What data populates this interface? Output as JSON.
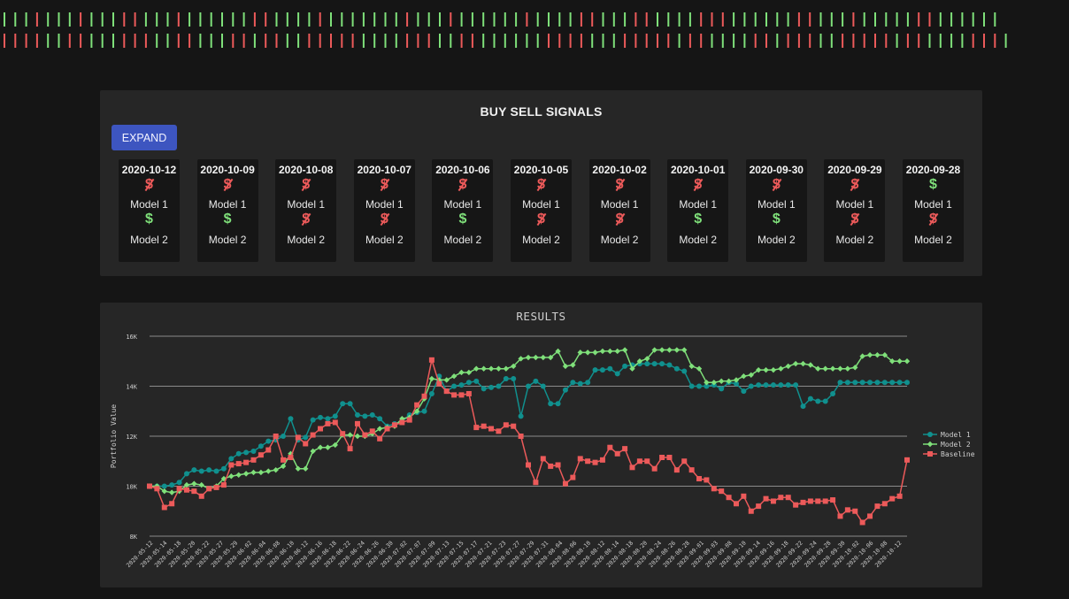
{
  "ticker_strip": {
    "colors": {
      "buy": "#7fe07a",
      "sell": "#ec5a5a"
    },
    "row1": "BBBSBBBSBBBSSBBBSBBBBBBSSBBBBSBBBBBBBSBBBSBBBBBBSBBBBSSBBBSSBBBBSSSBBBBBBSSBBBSBBBBBSSBBBBBB",
    "row2": "SSSSBBSSBBBSSSBBSSBBBSSBSSBBSSSSSBBBBSSSBBSSBBBBBBSSSSBBBSSSSSBSSBBBBSSBSSSBBSSSSSBSSBBBBSSSB"
  },
  "signals": {
    "title": "BUY SELL SIGNALS",
    "expand_label": "EXPAND",
    "icon_names": {
      "buy": "dollar-icon",
      "sell": "no-dollar-icon"
    },
    "cards": [
      {
        "date": "2020-10-12",
        "m1": "sell",
        "m1_label": "Model 1",
        "m2": "buy",
        "m2_label": "Model 2"
      },
      {
        "date": "2020-10-09",
        "m1": "sell",
        "m1_label": "Model 1",
        "m2": "buy",
        "m2_label": "Model 2"
      },
      {
        "date": "2020-10-08",
        "m1": "sell",
        "m1_label": "Model 1",
        "m2": "sell",
        "m2_label": "Model 2"
      },
      {
        "date": "2020-10-07",
        "m1": "sell",
        "m1_label": "Model 1",
        "m2": "sell",
        "m2_label": "Model 2"
      },
      {
        "date": "2020-10-06",
        "m1": "sell",
        "m1_label": "Model 1",
        "m2": "buy",
        "m2_label": "Model 2"
      },
      {
        "date": "2020-10-05",
        "m1": "sell",
        "m1_label": "Model 1",
        "m2": "sell",
        "m2_label": "Model 2"
      },
      {
        "date": "2020-10-02",
        "m1": "sell",
        "m1_label": "Model 1",
        "m2": "sell",
        "m2_label": "Model 2"
      },
      {
        "date": "2020-10-01",
        "m1": "sell",
        "m1_label": "Model 1",
        "m2": "buy",
        "m2_label": "Model 2"
      },
      {
        "date": "2020-09-30",
        "m1": "sell",
        "m1_label": "Model 1",
        "m2": "buy",
        "m2_label": "Model 2"
      },
      {
        "date": "2020-09-29",
        "m1": "sell",
        "m1_label": "Model 1",
        "m2": "sell",
        "m2_label": "Model 2"
      },
      {
        "date": "2020-09-28",
        "m1": "buy",
        "m1_label": "Model 1",
        "m2": "sell",
        "m2_label": "Model 2"
      }
    ]
  },
  "results": {
    "title": "RESULTS"
  },
  "chart_data": {
    "type": "line",
    "title": "RESULTS",
    "xlabel": "",
    "ylabel": "Portfolio Value",
    "ylim": [
      8000,
      16000
    ],
    "yticks": [
      8000,
      10000,
      12000,
      14000,
      16000
    ],
    "ytick_labels": [
      "8K",
      "10K",
      "12K",
      "14K",
      "16K"
    ],
    "grid": true,
    "legend_position": "right",
    "x_tick_labels": [
      "2020-05-12",
      "2020-05-14",
      "2020-05-18",
      "2020-05-20",
      "2020-05-22",
      "2020-05-27",
      "2020-05-29",
      "2020-06-02",
      "2020-06-04",
      "2020-06-08",
      "2020-06-10",
      "2020-06-12",
      "2020-06-16",
      "2020-06-18",
      "2020-06-22",
      "2020-06-24",
      "2020-06-26",
      "2020-06-30",
      "2020-07-02",
      "2020-07-07",
      "2020-07-09",
      "2020-07-13",
      "2020-07-15",
      "2020-07-17",
      "2020-07-21",
      "2020-07-23",
      "2020-07-27",
      "2020-07-29",
      "2020-07-31",
      "2020-08-04",
      "2020-08-06",
      "2020-08-10",
      "2020-08-12",
      "2020-08-14",
      "2020-08-18",
      "2020-08-20",
      "2020-08-24",
      "2020-08-26",
      "2020-08-28",
      "2020-09-01",
      "2020-09-03",
      "2020-09-08",
      "2020-09-10",
      "2020-09-14",
      "2020-09-16",
      "2020-09-18",
      "2020-09-22",
      "2020-09-24",
      "2020-09-28",
      "2020-09-30",
      "2020-10-02",
      "2020-10-06",
      "2020-10-08",
      "2020-10-12"
    ],
    "series": [
      {
        "name": "Model 1",
        "color": "#10908e",
        "marker": "circle",
        "values": [
          10000,
          10000,
          10000,
          10050,
          10150,
          10500,
          10650,
          10600,
          10650,
          10600,
          10700,
          11100,
          11300,
          11350,
          11400,
          11600,
          11800,
          11850,
          12000,
          12700,
          11850,
          11950,
          12650,
          12750,
          12700,
          12800,
          13300,
          13300,
          12850,
          12800,
          12850,
          12700,
          12400,
          12500,
          12600,
          12850,
          12950,
          13000,
          13700,
          14400,
          13800,
          14000,
          14050,
          14150,
          14200,
          13900,
          13950,
          14000,
          14300,
          14300,
          12800,
          14000,
          14200,
          14000,
          13300,
          13300,
          13850,
          14150,
          14100,
          14150,
          14650,
          14650,
          14700,
          14500,
          14800,
          14850,
          14900,
          14900,
          14900,
          14900,
          14850,
          14700,
          14600,
          14000,
          14000,
          14000,
          14050,
          13900,
          14150,
          14100,
          13800,
          14000,
          14050,
          14050,
          14050,
          14050,
          14050,
          14050,
          13200,
          13500,
          13400,
          13400,
          13700,
          14150,
          14150,
          14150,
          14150,
          14150,
          14150,
          14150,
          14150,
          14150,
          14150
        ]
      },
      {
        "name": "Model 2",
        "color": "#7fe07a",
        "marker": "diamond",
        "values": [
          10000,
          10000,
          9800,
          9750,
          9800,
          10050,
          10100,
          10050,
          9900,
          10000,
          10300,
          10400,
          10450,
          10500,
          10550,
          10550,
          10600,
          10650,
          10800,
          11300,
          10700,
          10700,
          11400,
          11550,
          11550,
          11650,
          12050,
          12050,
          12000,
          12000,
          12100,
          12300,
          12350,
          12400,
          12700,
          12750,
          13000,
          13500,
          14300,
          14250,
          14250,
          14400,
          14550,
          14550,
          14700,
          14700,
          14700,
          14700,
          14700,
          14800,
          15100,
          15150,
          15150,
          15150,
          15150,
          15400,
          14800,
          14850,
          15350,
          15350,
          15350,
          15400,
          15400,
          15400,
          15450,
          14700,
          15000,
          15100,
          15450,
          15450,
          15450,
          15450,
          15450,
          14800,
          14700,
          14150,
          14150,
          14200,
          14200,
          14250,
          14400,
          14450,
          14650,
          14650,
          14650,
          14700,
          14800,
          14900,
          14900,
          14850,
          14700,
          14700,
          14700,
          14700,
          14700,
          14750,
          15200,
          15250,
          15250,
          15250,
          15000,
          15000,
          15000
        ]
      },
      {
        "name": "Baseline",
        "color": "#ec5a5a",
        "marker": "square",
        "values": [
          10000,
          9900,
          9150,
          9300,
          9900,
          9850,
          9800,
          9600,
          9900,
          9950,
          10050,
          10850,
          10900,
          10950,
          11050,
          11250,
          11450,
          12000,
          11050,
          11150,
          11950,
          11700,
          12050,
          12300,
          12500,
          12550,
          12100,
          11500,
          12500,
          12050,
          12200,
          11900,
          12300,
          12450,
          12550,
          12650,
          13250,
          13600,
          15050,
          14100,
          13800,
          13650,
          13650,
          13700,
          12350,
          12400,
          12300,
          12200,
          12450,
          12400,
          12000,
          10850,
          10150,
          11100,
          10800,
          10850,
          10100,
          10350,
          11100,
          11000,
          10950,
          11050,
          11550,
          11300,
          11500,
          10750,
          11000,
          11000,
          10700,
          11150,
          11150,
          10650,
          11000,
          10650,
          10300,
          10250,
          9900,
          9800,
          9550,
          9300,
          9600,
          9000,
          9200,
          9500,
          9400,
          9550,
          9550,
          9250,
          9350,
          9400,
          9400,
          9400,
          9450,
          8800,
          9050,
          9000,
          8550,
          8800,
          9200,
          9300,
          9500,
          9600,
          11050
        ]
      }
    ]
  }
}
